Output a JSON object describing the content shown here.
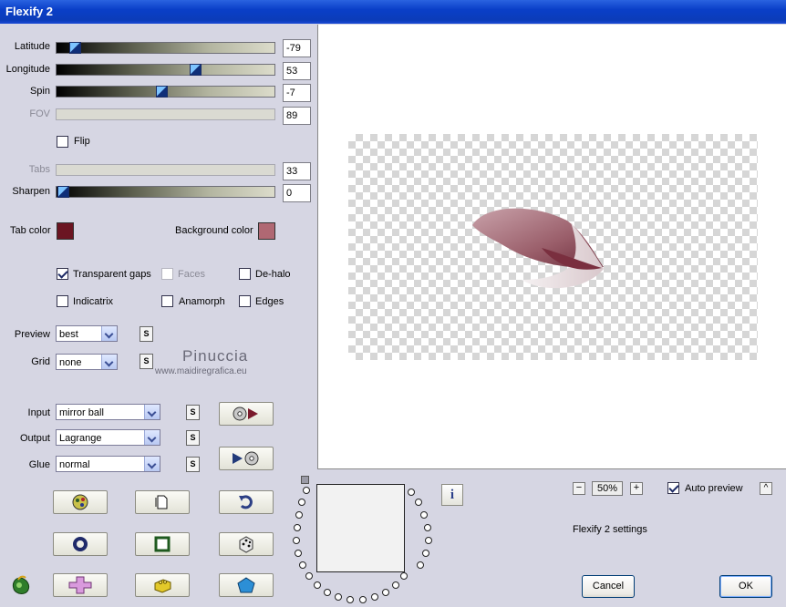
{
  "window": {
    "title": "Flexify 2"
  },
  "sliders": [
    {
      "label": "Latitude",
      "value": "-79",
      "enabled": true,
      "position": 0.06
    },
    {
      "label": "Longitude",
      "value": "53",
      "enabled": true,
      "position": 0.63
    },
    {
      "label": "Spin",
      "value": "-7",
      "enabled": true,
      "position": 0.46
    },
    {
      "label": "FOV",
      "value": "89",
      "enabled": false
    },
    {
      "label": "Tabs",
      "value": "33",
      "enabled": false
    },
    {
      "label": "Sharpen",
      "value": "0",
      "enabled": true,
      "position": 0.0
    }
  ],
  "flip": {
    "label": "Flip",
    "checked": false
  },
  "colors": {
    "tab_label": "Tab color",
    "tab_color": "#6b1522",
    "bg_label": "Background color",
    "bg_color": "#b06873"
  },
  "options": {
    "transparent_gaps": {
      "label": "Transparent gaps",
      "checked": true
    },
    "faces": {
      "label": "Faces",
      "checked": false,
      "enabled": false
    },
    "de_halo": {
      "label": "De-halo",
      "checked": false
    },
    "indicatrix": {
      "label": "Indicatrix",
      "checked": false
    },
    "anamorph": {
      "label": "Anamorph",
      "checked": false
    },
    "edges": {
      "label": "Edges",
      "checked": false
    }
  },
  "selects": {
    "preview": {
      "label": "Preview",
      "value": "best"
    },
    "grid": {
      "label": "Grid",
      "value": "none"
    },
    "input": {
      "label": "Input",
      "value": "mirror ball"
    },
    "output": {
      "label": "Output",
      "value": "Lagrange"
    },
    "glue": {
      "label": "Glue",
      "value": "normal"
    }
  },
  "s_label": "S",
  "watermark": {
    "name": "Pinuccia",
    "url": "www.maidiregrafica.eu"
  },
  "zoom": {
    "value": "50%",
    "minus": "−",
    "plus": "+"
  },
  "auto_preview": {
    "label": "Auto preview",
    "checked": true,
    "arrow": "^"
  },
  "settings_text": "Flexify 2 settings",
  "info_label": "i",
  "buttons": {
    "cancel": "Cancel",
    "ok": "OK"
  }
}
